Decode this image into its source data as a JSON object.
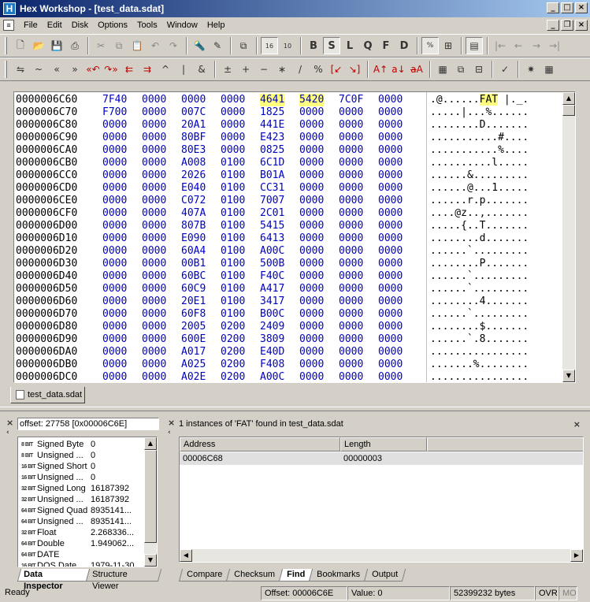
{
  "window": {
    "title": "Hex Workshop - [test_data.sdat]",
    "app_icon": "H"
  },
  "menu": [
    "File",
    "Edit",
    "Disk",
    "Options",
    "Tools",
    "Window",
    "Help"
  ],
  "toolbar1_bold": [
    "B",
    "S",
    "L",
    "Q",
    "F",
    "D"
  ],
  "hex": {
    "rows": [
      {
        "off": "0000006C60",
        "w": [
          "7F40",
          "0000",
          "0000",
          "0000",
          "4641",
          "5420",
          "7C0F",
          "0000"
        ],
        "a": ".@......FAT |._."
      },
      {
        "off": "0000006C70",
        "w": [
          "F700",
          "0000",
          "007C",
          "0000",
          "1825",
          "0000",
          "0000",
          "0000"
        ],
        "a": ".....|...%......"
      },
      {
        "off": "0000006C80",
        "w": [
          "0000",
          "0000",
          "20A1",
          "0000",
          "441E",
          "0000",
          "0000",
          "0000"
        ],
        "a": "........D......."
      },
      {
        "off": "0000006C90",
        "w": [
          "0000",
          "0000",
          "80BF",
          "0000",
          "E423",
          "0000",
          "0000",
          "0000"
        ],
        "a": "...........#...."
      },
      {
        "off": "0000006CA0",
        "w": [
          "0000",
          "0000",
          "80E3",
          "0000",
          "0825",
          "0000",
          "0000",
          "0000"
        ],
        "a": "...........%...."
      },
      {
        "off": "0000006CB0",
        "w": [
          "0000",
          "0000",
          "A008",
          "0100",
          "6C1D",
          "0000",
          "0000",
          "0000"
        ],
        "a": "..........l....."
      },
      {
        "off": "0000006CC0",
        "w": [
          "0000",
          "0000",
          "2026",
          "0100",
          "B01A",
          "0000",
          "0000",
          "0000"
        ],
        "a": "......&........."
      },
      {
        "off": "0000006CD0",
        "w": [
          "0000",
          "0000",
          "E040",
          "0100",
          "CC31",
          "0000",
          "0000",
          "0000"
        ],
        "a": "......@...1....."
      },
      {
        "off": "0000006CE0",
        "w": [
          "0000",
          "0000",
          "C072",
          "0100",
          "7007",
          "0000",
          "0000",
          "0000"
        ],
        "a": "......r.p......."
      },
      {
        "off": "0000006CF0",
        "w": [
          "0000",
          "0000",
          "407A",
          "0100",
          "2C01",
          "0000",
          "0000",
          "0000"
        ],
        "a": "....@z..,......."
      },
      {
        "off": "0000006D00",
        "w": [
          "0000",
          "0000",
          "807B",
          "0100",
          "5415",
          "0000",
          "0000",
          "0000"
        ],
        "a": ".....{..T......."
      },
      {
        "off": "0000006D10",
        "w": [
          "0000",
          "0000",
          "E090",
          "0100",
          "6413",
          "0000",
          "0000",
          "0000"
        ],
        "a": "........d......."
      },
      {
        "off": "0000006D20",
        "w": [
          "0000",
          "0000",
          "60A4",
          "0100",
          "A00C",
          "0000",
          "0000",
          "0000"
        ],
        "a": "......`........."
      },
      {
        "off": "0000006D30",
        "w": [
          "0000",
          "0000",
          "00B1",
          "0100",
          "500B",
          "0000",
          "0000",
          "0000"
        ],
        "a": "........P......."
      },
      {
        "off": "0000006D40",
        "w": [
          "0000",
          "0000",
          "60BC",
          "0100",
          "F40C",
          "0000",
          "0000",
          "0000"
        ],
        "a": "......`........."
      },
      {
        "off": "0000006D50",
        "w": [
          "0000",
          "0000",
          "60C9",
          "0100",
          "A417",
          "0000",
          "0000",
          "0000"
        ],
        "a": "......`........."
      },
      {
        "off": "0000006D60",
        "w": [
          "0000",
          "0000",
          "20E1",
          "0100",
          "3417",
          "0000",
          "0000",
          "0000"
        ],
        "a": "........4......."
      },
      {
        "off": "0000006D70",
        "w": [
          "0000",
          "0000",
          "60F8",
          "0100",
          "B00C",
          "0000",
          "0000",
          "0000"
        ],
        "a": "......`........."
      },
      {
        "off": "0000006D80",
        "w": [
          "0000",
          "0000",
          "2005",
          "0200",
          "2409",
          "0000",
          "0000",
          "0000"
        ],
        "a": "........$......."
      },
      {
        "off": "0000006D90",
        "w": [
          "0000",
          "0000",
          "600E",
          "0200",
          "3809",
          "0000",
          "0000",
          "0000"
        ],
        "a": "......`.8......."
      },
      {
        "off": "0000006DA0",
        "w": [
          "0000",
          "0000",
          "A017",
          "0200",
          "E40D",
          "0000",
          "0000",
          "0000"
        ],
        "a": "................"
      },
      {
        "off": "0000006DB0",
        "w": [
          "0000",
          "0000",
          "A025",
          "0200",
          "F408",
          "0000",
          "0000",
          "0000"
        ],
        "a": ".......%........"
      },
      {
        "off": "0000006DC0",
        "w": [
          "0000",
          "0000",
          "A02E",
          "0200",
          "A00C",
          "0000",
          "0000",
          "0000"
        ],
        "a": "................"
      }
    ]
  },
  "doc_tab": "test_data.sdat",
  "inspector": {
    "offset_label": "offset: 27758 [0x00006C6E]",
    "rows": [
      {
        "bits": "8 BIT",
        "name": "Signed Byte",
        "value": "0"
      },
      {
        "bits": "8 BIT",
        "name": "Unsigned ...",
        "value": "0"
      },
      {
        "bits": "16 BIT",
        "name": "Signed Short",
        "value": "0"
      },
      {
        "bits": "16 BIT",
        "name": "Unsigned ...",
        "value": "0"
      },
      {
        "bits": "32 BIT",
        "name": "Signed Long",
        "value": "16187392"
      },
      {
        "bits": "32 BIT",
        "name": "Unsigned ...",
        "value": "16187392"
      },
      {
        "bits": "64 BIT",
        "name": "Signed Quad",
        "value": "8935141..."
      },
      {
        "bits": "64 BIT",
        "name": "Unsigned ...",
        "value": "8935141..."
      },
      {
        "bits": "32 BIT",
        "name": "Float",
        "value": "2.268336..."
      },
      {
        "bits": "64 BIT",
        "name": "Double",
        "value": "1.949062..."
      },
      {
        "bits": "64 BIT",
        "name": "DATE",
        "value": ""
      },
      {
        "bits": "16 BIT",
        "name": "DOS Date",
        "value": "1979-11-30"
      }
    ],
    "tabs": [
      "Data Inspector",
      "Structure Viewer"
    ]
  },
  "find": {
    "status": "1 instances of 'FAT' found in test_data.sdat",
    "columns": [
      "Address",
      "Length"
    ],
    "rows": [
      {
        "address": "00006C68",
        "length": "00000003"
      }
    ],
    "tabs": [
      "Compare",
      "Checksum",
      "Find",
      "Bookmarks",
      "Output"
    ]
  },
  "status": {
    "ready": "Ready",
    "offset": "Offset: 00006C6E",
    "value": "Value: 0",
    "size": "52399232 bytes",
    "ovr": "OVR",
    "mo": "MO"
  }
}
